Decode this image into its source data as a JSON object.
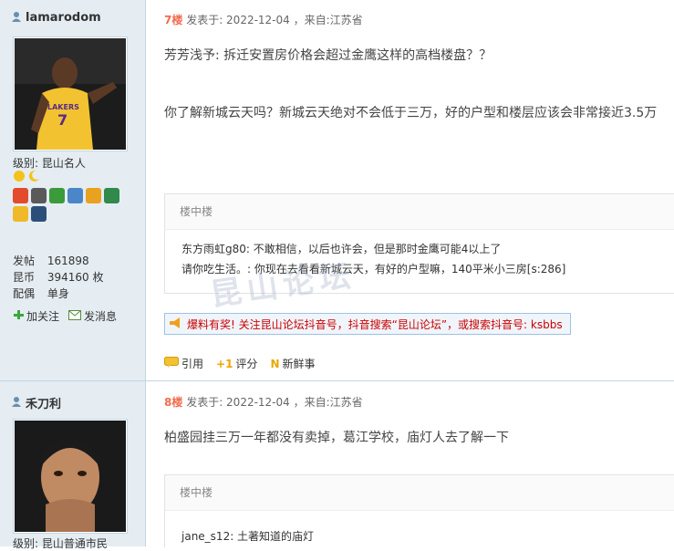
{
  "post1": {
    "username": "lamarodom",
    "level_label": "级别: 昆山名人",
    "stats": [
      {
        "k": "发帖",
        "v": "161898"
      },
      {
        "k": "昆币",
        "v": "394160 枚"
      },
      {
        "k": "配偶",
        "v": "单身"
      }
    ],
    "follow": "加关注",
    "message": "发消息",
    "floor": "7楼",
    "posted_at": "发表于: 2022-12-04 ，来自:江苏省",
    "quote_line": "芳芳浅予: 拆迁安置房价格会超过金鹰这样的高档楼盘？？",
    "body_line": "你了解新城云天吗？新城云天绝对不会低于三万，好的户型和楼层应该会非常接近3.5万",
    "comment_title": "楼中楼",
    "comments": [
      "东方雨虹g80: 不敢相信，以后也许会，但是那时金鹰可能4以上了",
      "请你吃生活。: 你现在去看看新城云天，有好的户型嘛，140平米小三房[s:286]"
    ],
    "ad": "爆料有奖! 关注昆山论坛抖音号，抖音搜索“昆山论坛”，或搜索抖音号: ksbbs",
    "quote_btn": "引用",
    "score_btn": "评分",
    "fresh_btn": "新鲜事"
  },
  "post2": {
    "username": "禾刀利",
    "level_label": "级别: 昆山普通市民",
    "floor": "8楼",
    "posted_at": "发表于: 2022-12-04 ，来自:江苏省",
    "body_line": "柏盛园挂三万一年都没有卖掉，葛江学校，庙灯人去了解一下",
    "comment_title": "楼中楼",
    "comments": [
      "jane_s12: 土著知道的庙灯"
    ]
  },
  "watermark": "昆山论坛",
  "colors": {
    "sidebar": "#e5edf2",
    "floor": "#f26c4f",
    "ad_text": "#cc0000"
  }
}
